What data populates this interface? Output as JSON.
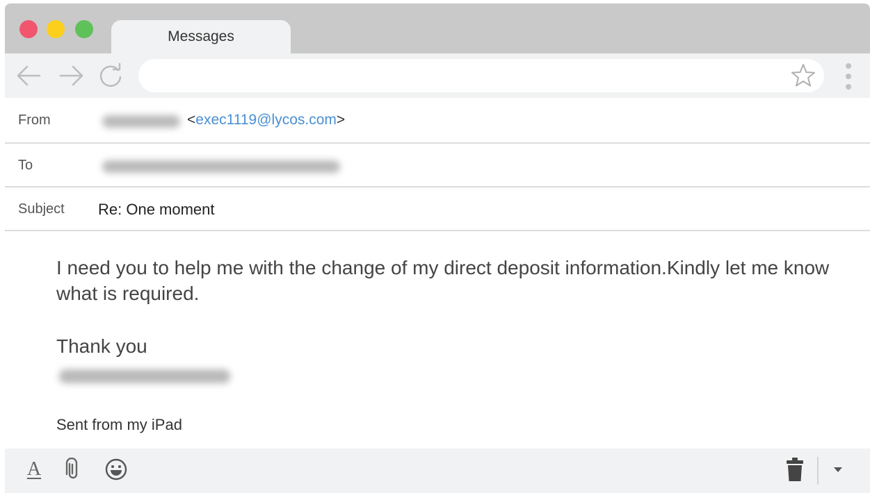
{
  "window": {
    "tab_title": "Messages",
    "address_value": ""
  },
  "icons": {
    "back": "arrow-left-icon",
    "forward": "arrow-right-icon",
    "reload": "reload-icon",
    "bookmark": "star-icon",
    "menu": "kebab-menu-icon",
    "format": "text-format-icon",
    "attach": "paperclip-icon",
    "emoji": "smiley-icon",
    "delete": "trash-icon",
    "more": "caret-down-icon"
  },
  "email": {
    "from_label": "From",
    "from_addr_open": "<",
    "from_email": "exec1119@lycos.com",
    "from_addr_close": ">",
    "to_label": "To",
    "subject_label": "Subject",
    "subject": "Re: One moment",
    "body": "I need you to help me with the change of my direct deposit information.Kindly let me know what is required.",
    "closing": "Thank you",
    "footer_note": "Sent from my iPad"
  },
  "colors": {
    "link": "#4a8fd4",
    "chrome": "#c9c9c9",
    "toolbar": "#f1f2f3"
  }
}
